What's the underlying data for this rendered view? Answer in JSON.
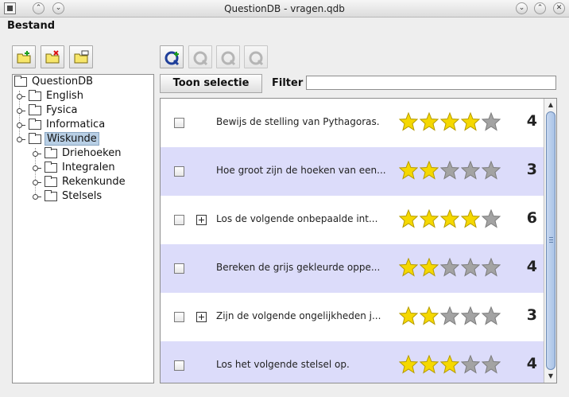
{
  "window": {
    "title": "QuestionDB - vragen.qdb"
  },
  "menu": {
    "bestand": "Bestand"
  },
  "toolbar_left": {
    "icons": [
      "new-folder-icon",
      "delete-folder-icon",
      "rename-folder-icon"
    ]
  },
  "toolbar_right": {
    "icons": [
      "new-question-icon",
      "edit-question-icon",
      "copy-question-icon",
      "delete-question-icon"
    ]
  },
  "tree": {
    "root": "QuestionDB",
    "items": [
      "English",
      "Fysica",
      "Informatica",
      "Wiskunde"
    ],
    "selected": "Wiskunde",
    "children": [
      "Driehoeken",
      "Integralen",
      "Rekenkunde",
      "Stelsels"
    ]
  },
  "filter_bar": {
    "button": "Toon selectie",
    "label": "Filter",
    "value": ""
  },
  "questions": [
    {
      "text": "Bewijs de stelling van Pythagoras.",
      "rating": 4,
      "count": "4",
      "expandable": false
    },
    {
      "text": "Hoe groot zijn de hoeken van een...",
      "rating": 2,
      "count": "3",
      "expandable": false
    },
    {
      "text": "Los de volgende onbepaalde int...",
      "rating": 4,
      "count": "6",
      "expandable": true
    },
    {
      "text": "Bereken de grijs gekleurde oppe...",
      "rating": 2,
      "count": "4",
      "expandable": false
    },
    {
      "text": "Zijn de volgende ongelijkheden j...",
      "rating": 2,
      "count": "3",
      "expandable": true
    },
    {
      "text": "Los het volgende stelsel op.",
      "rating": 3,
      "count": "4",
      "expandable": false
    }
  ],
  "colors": {
    "star_on": "#f5d800",
    "star_off": "#a3a3a3",
    "row_alt": "#dcdcfa",
    "selection": "#b8cfe5"
  }
}
